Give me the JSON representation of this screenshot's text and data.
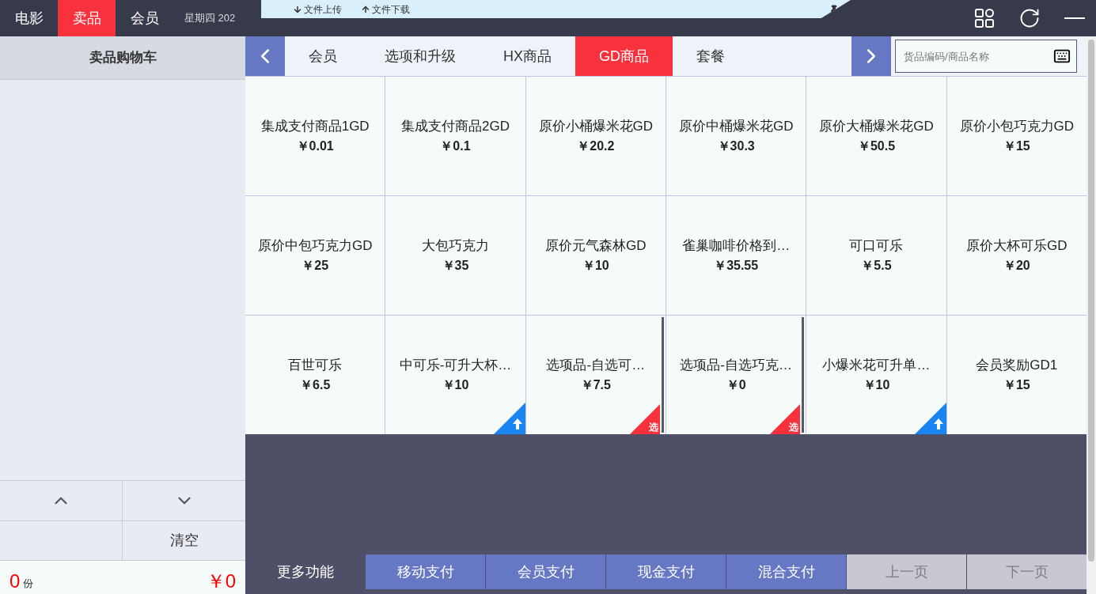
{
  "top_nav": [
    {
      "label": "电影",
      "selected": false
    },
    {
      "label": "卖品",
      "selected": true
    },
    {
      "label": "会员",
      "selected": false
    }
  ],
  "status_text": "星期四 202",
  "file_panel": {
    "upload": "文件上传",
    "download": "文件下载"
  },
  "cart": {
    "title": "卖品购物车",
    "clear": "清空",
    "count": "0",
    "unit": "份",
    "total": "￥0"
  },
  "category_tabs": [
    {
      "label": "会员",
      "selected": false
    },
    {
      "label": "选项和升级",
      "selected": false
    },
    {
      "label": "HX商品",
      "selected": false
    },
    {
      "label": "GD商品",
      "selected": true
    },
    {
      "label": "套餐",
      "selected": false
    }
  ],
  "search": {
    "placeholder": "货品编码/商品名称"
  },
  "products": [
    {
      "name": "集成支付商品1GD",
      "price": "￥0.01"
    },
    {
      "name": "集成支付商品2GD",
      "price": "￥0.1"
    },
    {
      "name": "原价小桶爆米花GD",
      "price": "￥20.2"
    },
    {
      "name": "原价中桶爆米花GD",
      "price": "￥30.3"
    },
    {
      "name": "原价大桶爆米花GD",
      "price": "￥50.5"
    },
    {
      "name": "原价小包巧克力GD",
      "price": "￥15"
    },
    {
      "name": "原价中包巧克力GD",
      "price": "￥25"
    },
    {
      "name": "大包巧克力",
      "price": "￥35"
    },
    {
      "name": "原价元气森林GD",
      "price": "￥10"
    },
    {
      "name": "雀巢咖啡价格到…",
      "price": "￥35.55"
    },
    {
      "name": "可口可乐",
      "price": "￥5.5"
    },
    {
      "name": "原价大杯可乐GD",
      "price": "￥20"
    },
    {
      "name": "百世可乐",
      "price": "￥6.5"
    },
    {
      "name": "中可乐-可升大杯…",
      "price": "￥10",
      "badge": {
        "kind": "upgrade"
      }
    },
    {
      "name": "选项品-自选可…",
      "price": "￥7.5",
      "badge": {
        "kind": "option",
        "text": "选"
      }
    },
    {
      "name": "选项品-自选巧克…",
      "price": "￥0",
      "badge": {
        "kind": "option",
        "text": "选"
      }
    },
    {
      "name": "小爆米花可升单…",
      "price": "￥10",
      "badge": {
        "kind": "upgrade"
      }
    },
    {
      "name": "会员奖励GD1",
      "price": "￥15"
    }
  ],
  "actions": [
    {
      "label": "更多功能",
      "kind": "dark",
      "disabled": false
    },
    {
      "label": "移动支付",
      "kind": "pay",
      "disabled": false
    },
    {
      "label": "会员支付",
      "kind": "pay",
      "disabled": false
    },
    {
      "label": "现金支付",
      "kind": "pay",
      "disabled": false
    },
    {
      "label": "混合支付",
      "kind": "pay",
      "disabled": false
    },
    {
      "label": "上一页",
      "kind": "page",
      "disabled": true
    },
    {
      "label": "下一页",
      "kind": "page",
      "disabled": true
    }
  ]
}
